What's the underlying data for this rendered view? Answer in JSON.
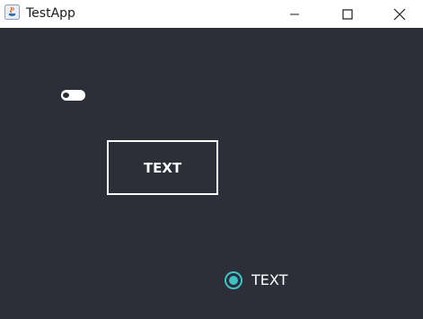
{
  "window": {
    "title": "TestApp",
    "icon": "java-app-icon",
    "controls": {
      "minimize": "minimize-icon",
      "maximize": "maximize-icon",
      "close": "close-icon"
    }
  },
  "colors": {
    "background": "#2d2f38",
    "foreground": "#ffffff",
    "accent": "#3ec1c9"
  },
  "toggle": {
    "state": "off"
  },
  "button": {
    "label": "TEXT"
  },
  "radio": {
    "label": "TEXT",
    "selected": true
  }
}
